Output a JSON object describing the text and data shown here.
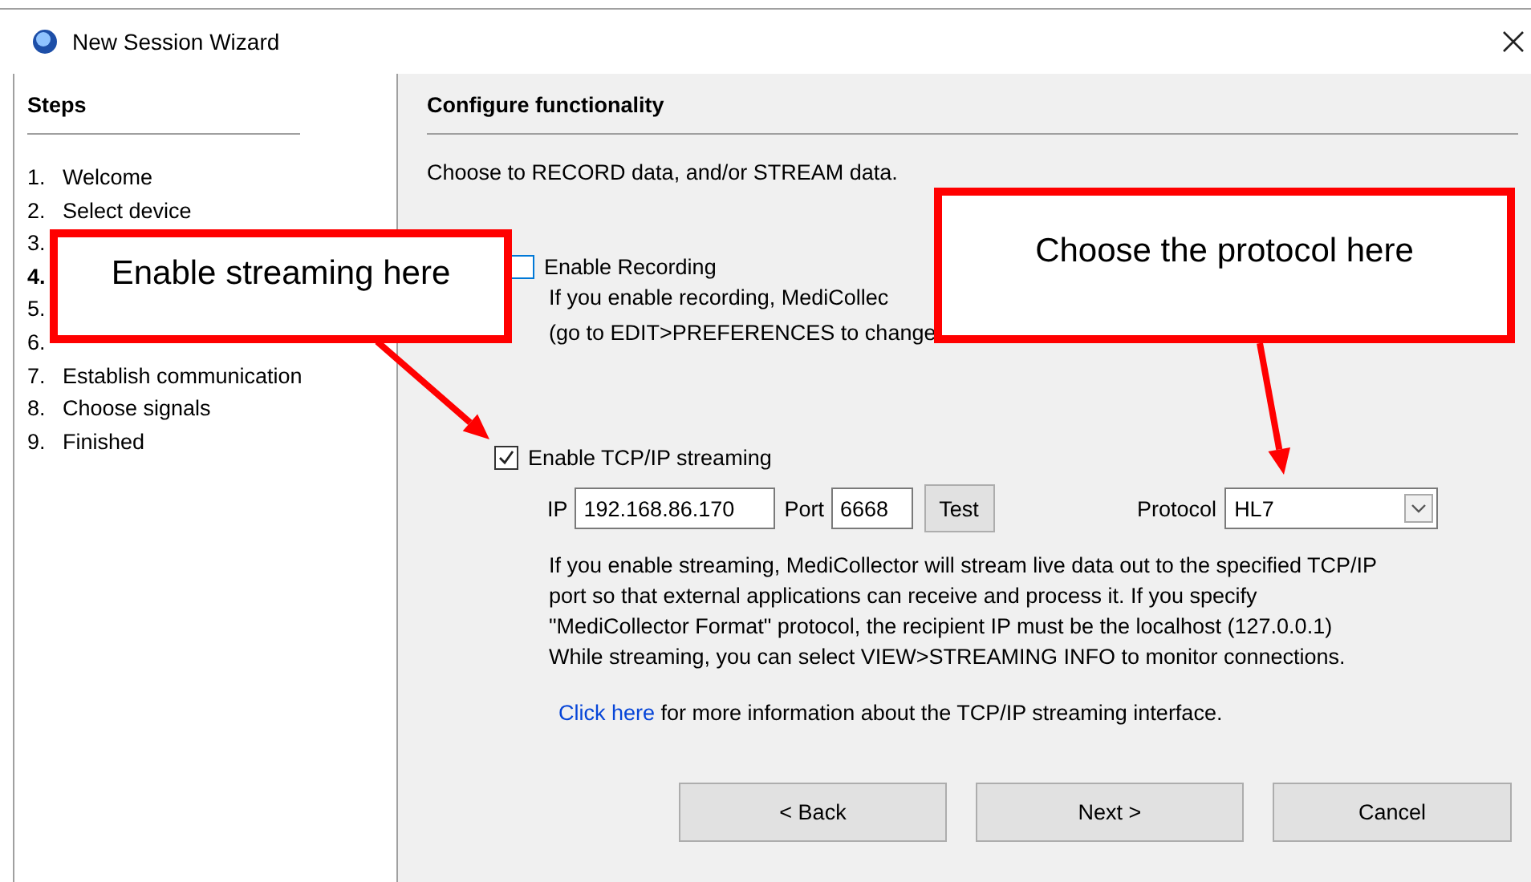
{
  "window": {
    "title": "New Session Wizard"
  },
  "sidebar": {
    "heading": "Steps",
    "steps": [
      {
        "number": "1.",
        "label": "Welcome",
        "selected": false
      },
      {
        "number": "2.",
        "label": "Select device",
        "selected": false
      },
      {
        "number": "3.",
        "selected": false
      },
      {
        "number": "4.",
        "selected": true
      },
      {
        "number": "5.",
        "selected": false
      },
      {
        "number": "6.",
        "selected": false
      },
      {
        "number": "7.",
        "label": "Establish communication",
        "selected": false
      },
      {
        "number": "8.",
        "label": "Choose signals",
        "selected": false
      },
      {
        "number": "9.",
        "label": "Finished",
        "selected": false
      }
    ]
  },
  "content": {
    "heading": "Configure functionality",
    "intro": "Choose to RECORD data, and/or STREAM data.",
    "recording": {
      "label": "Enable Recording",
      "checked": false,
      "description": [
        "If you enable recording, MediCollec",
        "(go to EDIT>PREFERENCES to change"
      ]
    },
    "streaming": {
      "label": "Enable TCP/IP streaming",
      "checked": true,
      "ip_label": "IP",
      "ip": "192.168.86.170",
      "port_label": "Port",
      "port": "6668",
      "test_button": "Test",
      "protocol_label": "Protocol",
      "protocol": "HL7",
      "description": [
        "If you enable streaming, MediCollector will stream live data out to the specified TCP/IP",
        "port so that external applications can receive and process it.  If you specify",
        "\"MediCollector Format\" protocol, the recipient IP must be the localhost (127.0.0.1)",
        "While streaming, you can select VIEW>STREAMING INFO to monitor connections."
      ]
    },
    "info": {
      "link": "Click here",
      "text": " for more information about the TCP/IP streaming interface."
    },
    "buttons": [
      "< Back",
      "Next >",
      "Cancel"
    ]
  },
  "annotations": [
    {
      "text": "Enable streaming here"
    },
    {
      "text": "Choose the protocol here"
    }
  ]
}
